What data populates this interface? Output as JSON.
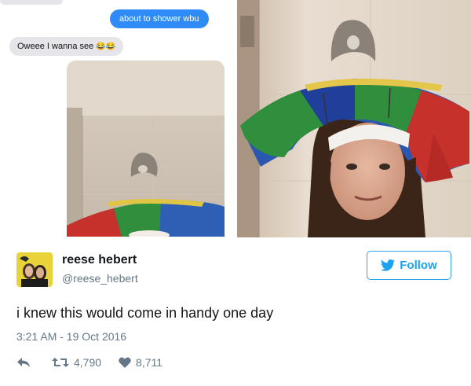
{
  "messages": {
    "outgoing": "about to shower wbu",
    "incoming": "Oweee I wanna see",
    "incoming_emoji": "😂😂"
  },
  "tweet": {
    "display_name": "reese hebert",
    "handle": "@reese_hebert",
    "text": "i knew this would come in handy one day",
    "timestamp": "3:21 AM - 19 Oct 2016",
    "follow_label": "Follow",
    "retweets": "4,790",
    "likes": "8,711"
  },
  "icons": {
    "reply": "reply-icon",
    "retweet": "retweet-icon",
    "like": "heart-icon",
    "follow_bird": "twitter-bird-icon"
  },
  "colors": {
    "imessage_blue": "#2f8cf6",
    "twitter_blue": "#1da1f2",
    "meta_gray": "#657786"
  }
}
